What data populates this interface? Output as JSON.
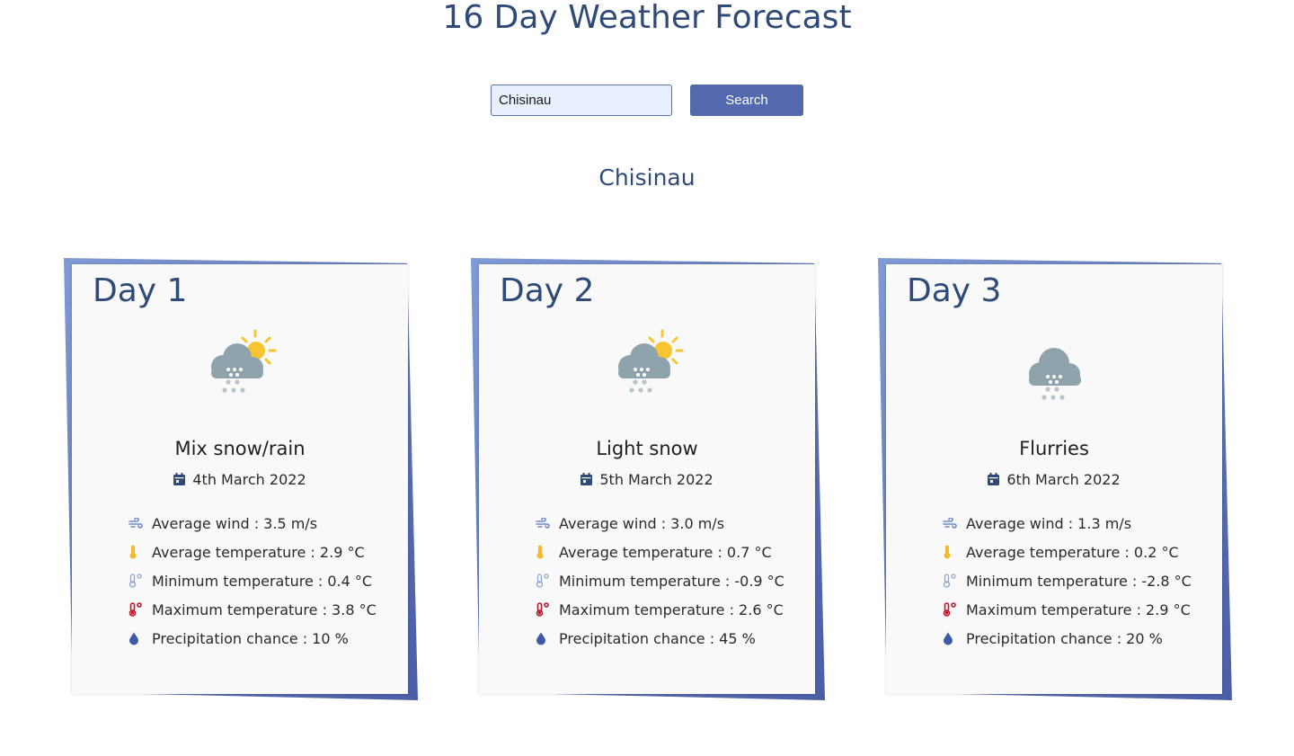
{
  "page": {
    "title": "16 Day Weather Forecast"
  },
  "search": {
    "value": "Chisinau",
    "button_label": "Search"
  },
  "location": {
    "name": "Chisinau"
  },
  "colors": {
    "accent": "#5468ad",
    "title": "#2f4a78",
    "card_bg": "#f9f9f9"
  },
  "days": [
    {
      "label": "Day 1",
      "condition": "Mix snow/rain",
      "date": "4th March 2022",
      "icon": "partly-sunny-snow-icon",
      "stats": {
        "wind": "Average wind : 3.5 m/s",
        "avg_temp": "Average temperature : 2.9 °C",
        "min_temp": "Minimum temperature : 0.4 °C",
        "max_temp": "Maximum temperature : 3.8 °C",
        "precip": "Precipitation chance : 10 %"
      }
    },
    {
      "label": "Day 2",
      "condition": "Light snow",
      "date": "5th March 2022",
      "icon": "partly-sunny-snow-icon",
      "stats": {
        "wind": "Average wind : 3.0 m/s",
        "avg_temp": "Average temperature : 0.7 °C",
        "min_temp": "Minimum temperature : -0.9 °C",
        "max_temp": "Maximum temperature : 2.6 °C",
        "precip": "Precipitation chance : 45 %"
      }
    },
    {
      "label": "Day 3",
      "condition": "Flurries",
      "date": "6th March 2022",
      "icon": "snow-cloud-icon",
      "stats": {
        "wind": "Average wind : 1.3 m/s",
        "avg_temp": "Average temperature : 0.2 °C",
        "min_temp": "Minimum temperature : -2.8 °C",
        "max_temp": "Maximum temperature : 2.9 °C",
        "precip": "Precipitation chance : 20 %"
      }
    }
  ]
}
